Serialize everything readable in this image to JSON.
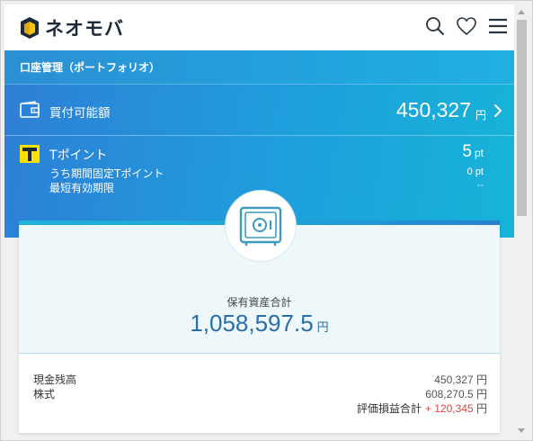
{
  "brand": {
    "name": "ネオモバ",
    "icon": "neomoba-logo-icon"
  },
  "header": {
    "icons": [
      "search-icon",
      "heart-icon",
      "menu-icon"
    ]
  },
  "section": {
    "title": "口座管理（ポートフォリオ）"
  },
  "buying_power": {
    "label": "買付可能額",
    "amount": "450,327",
    "unit": "円",
    "icon": "wallet-icon"
  },
  "tpoint": {
    "label": "Tポイント",
    "value": "5",
    "unit": "pt",
    "fixed_label": "うち期間固定Tポイント",
    "fixed_value": "0 pt",
    "expiry_label": "最短有効期限",
    "expiry_value": "--",
    "icon": "tpoint-icon"
  },
  "summary": {
    "icon": "safe-icon",
    "total_label": "保有資産合計",
    "total_amount": "1,058,597.5",
    "total_unit": "円",
    "rows": [
      {
        "label": "現金残高",
        "value": "450,327 円"
      },
      {
        "label": "株式",
        "value": "608,270.5 円"
      }
    ],
    "gain": {
      "label": "評価損益合計",
      "value": "+ 120,345",
      "unit": "円"
    }
  },
  "colors": {
    "brand_blue": "#2a7fd4",
    "accent_cyan": "#17b4d8",
    "total_text": "#2a6ea6",
    "gain_red": "#e0453a"
  }
}
